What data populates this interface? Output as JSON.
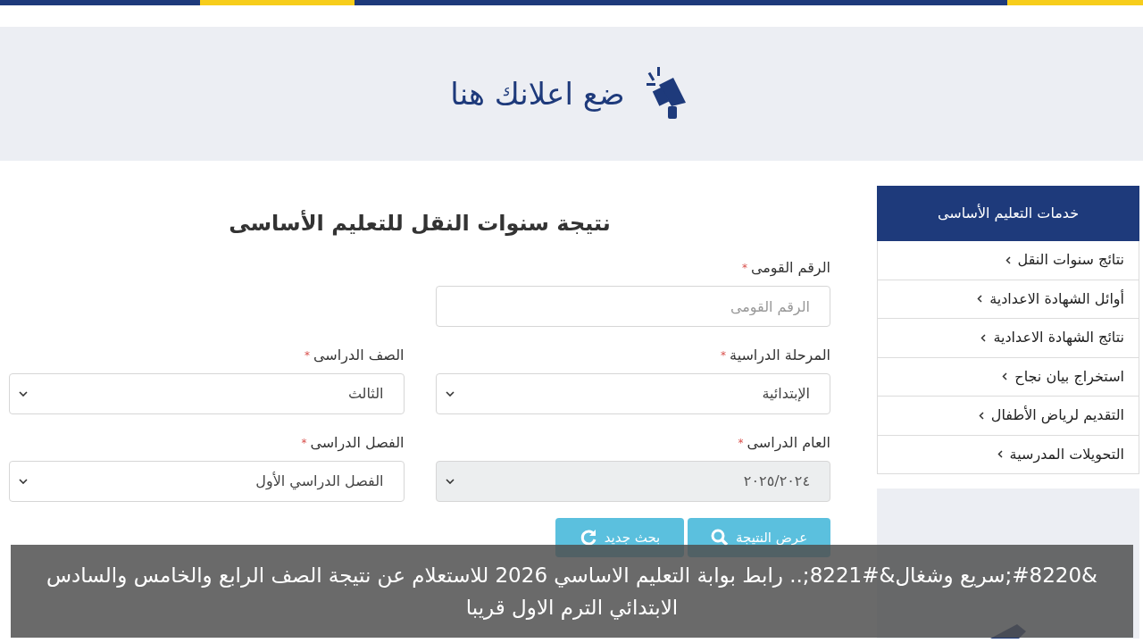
{
  "top_stripe": [
    {
      "color": "#1e3a7b"
    },
    {
      "color": "#f7cd1b"
    },
    {
      "color": "#1e3a7b"
    },
    {
      "color": "#f7cd1b"
    }
  ],
  "ad_banner": {
    "text": "ضع اعلانك هنا"
  },
  "sidebar": {
    "title": "خدمات التعليم الأساسى",
    "items": [
      {
        "label": "نتائج سنوات النقل"
      },
      {
        "label": "أوائل الشهادة الاعدادية"
      },
      {
        "label": "نتائج الشهادة الاعدادية"
      },
      {
        "label": "استخراج بيان نجاح"
      },
      {
        "label": "التقديم لرياض الأطفال"
      },
      {
        "label": "التحويلات المدرسية"
      }
    ]
  },
  "form": {
    "title": "نتيجة سنوات النقل للتعليم الأساسى",
    "fields": [
      {
        "kind": "text",
        "label": "الرقم القومى",
        "asterisk": "*",
        "placeholder": "الرقم القومى",
        "disabled": false
      },
      {
        "kind": "select",
        "label": "المرحلة الدراسية",
        "asterisk": "*",
        "value": "الإبتدائية",
        "disabled": false
      },
      {
        "kind": "select",
        "label": "الصف الدراسى",
        "asterisk": "*",
        "value": "الثالث",
        "disabled": false
      },
      {
        "kind": "select",
        "label": "العام الدراسى",
        "asterisk": "*",
        "value": "٢٠٢٥/٢٠٢٤",
        "disabled": true
      },
      {
        "kind": "select",
        "label": "الفصل الدراسى",
        "asterisk": "*",
        "value": "الفصل الدراسي الأول",
        "disabled": false
      }
    ],
    "buttons": [
      {
        "label": "عرض النتيجة"
      },
      {
        "label": "بحث جديد"
      }
    ]
  },
  "caption": {
    "text": "&#8220;سريع وشغال&#8221;.. رابط بوابة التعليم الاساسي 2026 للاستعلام عن نتيجة الصف الرابع والخامس والسادس الابتدائي الترم الاول قريبا"
  }
}
